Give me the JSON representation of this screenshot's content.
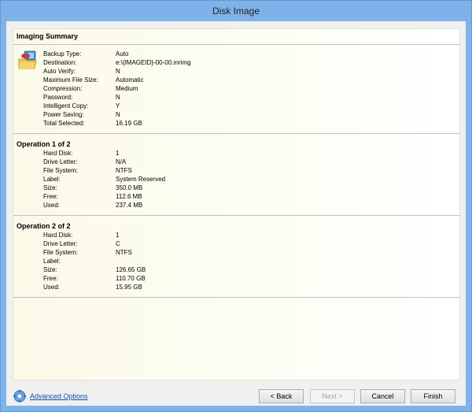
{
  "window": {
    "title": "Disk Image"
  },
  "summary": {
    "heading": "Imaging Summary",
    "rows": [
      {
        "label": "Backup Type:",
        "value": "Auto"
      },
      {
        "label": "Destination:",
        "value": "e:\\{IMAGEID}-00-00.mrimg"
      },
      {
        "label": "Auto Verify:",
        "value": "N"
      },
      {
        "label": "Maximum File Size:",
        "value": "Automatic"
      },
      {
        "label": "Compression:",
        "value": "Medium"
      },
      {
        "label": "Password:",
        "value": "N"
      },
      {
        "label": "Intelligent Copy:",
        "value": "Y"
      },
      {
        "label": "Power Saving:",
        "value": "N"
      },
      {
        "label": "Total Selected:",
        "value": "16.19 GB"
      }
    ]
  },
  "operations": [
    {
      "heading": "Operation 1 of 2",
      "rows": [
        {
          "label": "Hard Disk:",
          "value": "1"
        },
        {
          "label": "Drive Letter:",
          "value": "N/A"
        },
        {
          "label": "File System:",
          "value": "NTFS"
        },
        {
          "label": "Label:",
          "value": "System Reserved"
        },
        {
          "label": "Size:",
          "value": "350.0 MB"
        },
        {
          "label": "Free:",
          "value": "112.6 MB"
        },
        {
          "label": "Used:",
          "value": "237.4 MB"
        }
      ]
    },
    {
      "heading": "Operation 2 of 2",
      "rows": [
        {
          "label": "Hard Disk:",
          "value": "1"
        },
        {
          "label": "Drive Letter:",
          "value": "C"
        },
        {
          "label": "File System:",
          "value": "NTFS"
        },
        {
          "label": "Label:",
          "value": ""
        },
        {
          "label": "Size:",
          "value": "126.65 GB"
        },
        {
          "label": "Free:",
          "value": "110.70 GB"
        },
        {
          "label": "Used:",
          "value": "15.95 GB"
        }
      ]
    }
  ],
  "footer": {
    "advanced_options": "Advanced Options",
    "back": "< Back",
    "next": "Next >",
    "cancel": "Cancel",
    "finish": "Finish"
  }
}
